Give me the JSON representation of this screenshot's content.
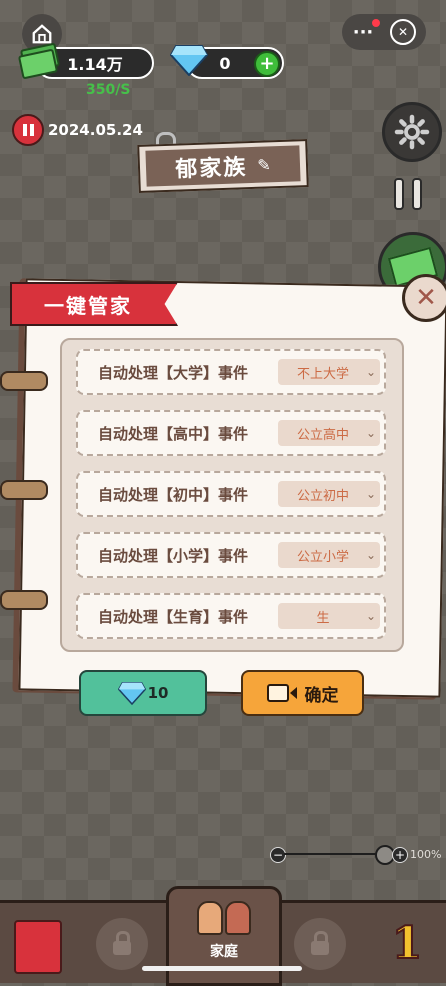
{
  "hud": {
    "money": "1.14万",
    "money_rate": "350/S",
    "diamonds": "0",
    "date": "2024.05.24",
    "family_name": "郁家族"
  },
  "dialog": {
    "title": "一键管家",
    "rows": [
      {
        "label": "自动处理【大学】事件",
        "value": "不上大学"
      },
      {
        "label": "自动处理【高中】事件",
        "value": "公立高中"
      },
      {
        "label": "自动处理【初中】事件",
        "value": "公立初中"
      },
      {
        "label": "自动处理【小学】事件",
        "value": "公立小学"
      },
      {
        "label": "自动处理【生育】事件",
        "value": "生"
      }
    ],
    "diamond_cost": "10",
    "confirm_label": "确定"
  },
  "zoom": {
    "label": "100%",
    "level": 0.95
  },
  "bottom_nav": {
    "family_label": "家庭"
  },
  "colors": {
    "accent_red": "#d8323c",
    "diamond_button": "#52c19b",
    "confirm_button": "#f6a53a"
  }
}
